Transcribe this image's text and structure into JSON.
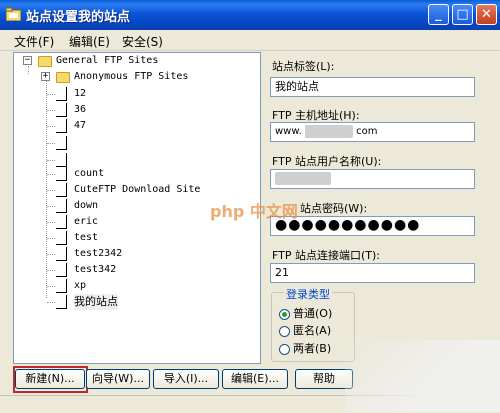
{
  "window": {
    "title": "站点设置我的站点",
    "controls": {
      "minimize": "_",
      "maximize": "□",
      "close": "✕"
    }
  },
  "menu": [
    "文件(F)",
    "编辑(E)",
    "安全(S)"
  ],
  "tree": {
    "root": "General FTP Sites",
    "child_folder": "Anonymous FTP Sites",
    "items": [
      "12",
      "36",
      "47",
      "",
      "",
      "count",
      "CuteFTP Download Site",
      "down",
      "eric",
      "test",
      "test2342",
      "test342",
      "xp",
      "我的站点"
    ]
  },
  "fields": {
    "label_label": "站点标签(L):",
    "label_value": "我的站点",
    "host_label": "FTP 主机地址(H):",
    "host_prefix": "www.",
    "host_suffix": "com",
    "user_label": "FTP 站点用户名称(U):",
    "password_label": "站点密码(W):",
    "password_value": "●●●●●●●●●●●",
    "port_label": "FTP 站点连接端口(T):",
    "port_value": "21"
  },
  "login_type": {
    "title": "登录类型",
    "options": [
      "普通(O)",
      "匿名(A)",
      "两者(B)"
    ],
    "selected_index": 0
  },
  "buttons": [
    "新建(N)...",
    "向导(W)...",
    "导入(I)...",
    "编辑(E)...",
    "帮助"
  ],
  "watermark": "php 中文网",
  "colors": {
    "title_bar": "#0a5fd6",
    "window_bg": "#ece9d8",
    "highlight_box": "#c0282c"
  }
}
